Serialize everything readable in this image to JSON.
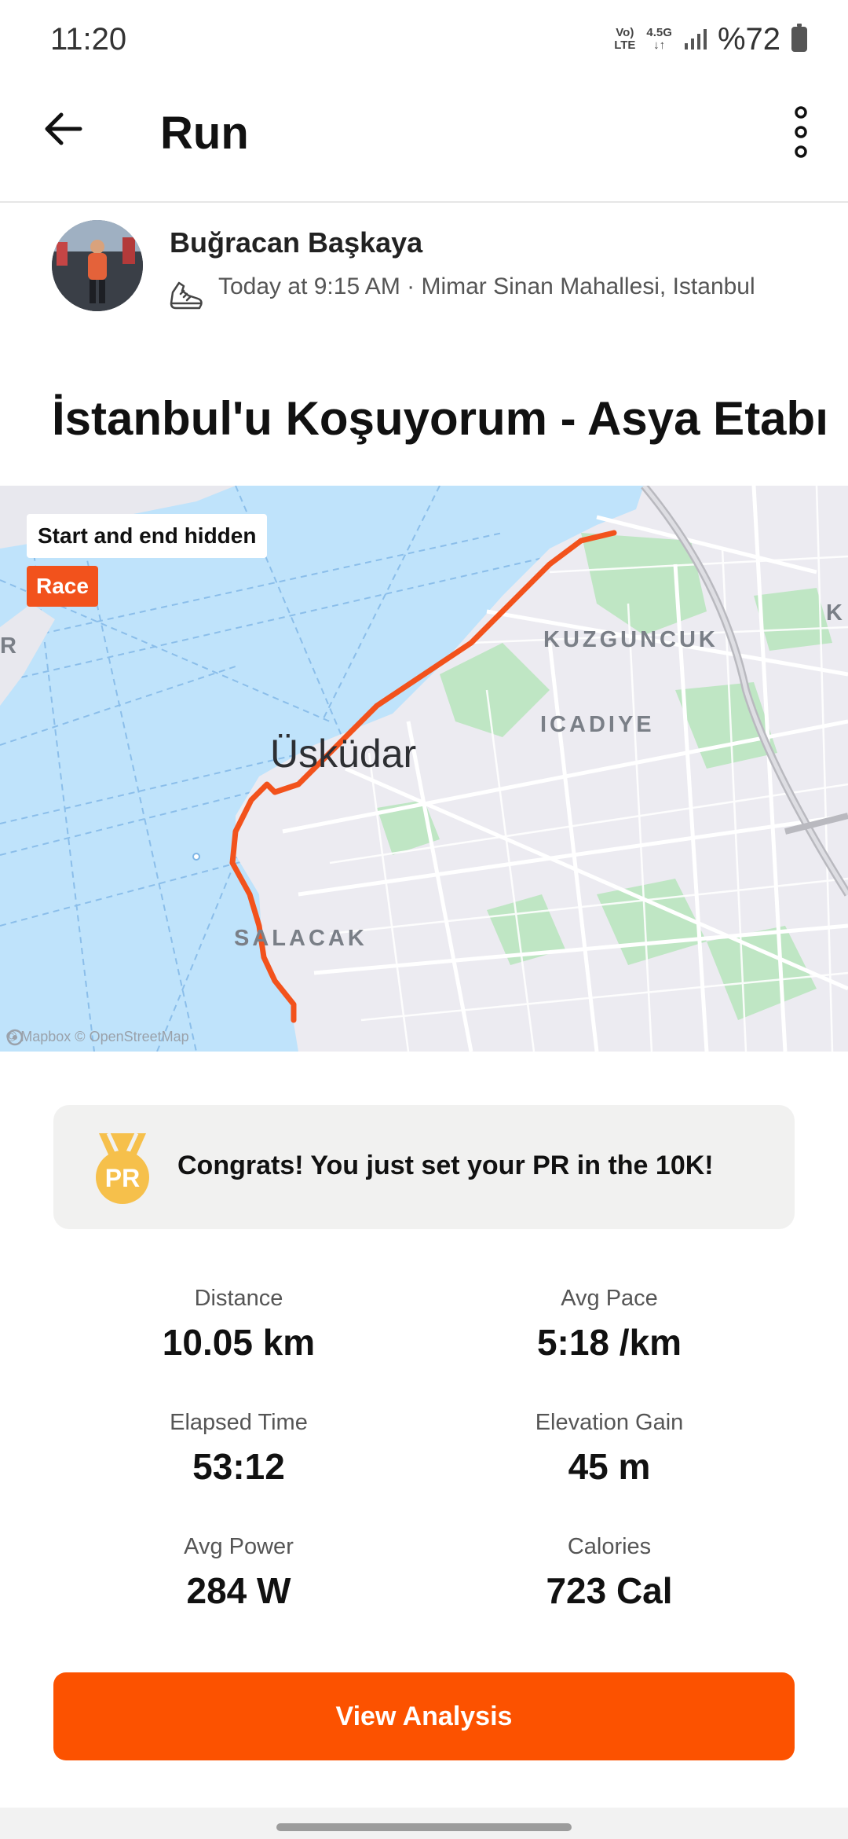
{
  "status_bar": {
    "time": "11:20",
    "network_top": "Vo)\nLTE",
    "network_mid": "4.5G",
    "battery": "%72"
  },
  "app_bar": {
    "title": "Run",
    "back_icon": "arrow-left-icon",
    "more_icon": "more-vertical-icon"
  },
  "athlete": {
    "name": "Buğracan Başkaya",
    "meta": "Today at 9:15 AM · Mimar Sinan Mahallesi, Istanbul",
    "activity_icon": "running-shoe-icon"
  },
  "activity": {
    "title": "İstanbul'u Koşuyorum - Asya Etabı"
  },
  "map": {
    "privacy_label": "Start and end hidden",
    "race_badge": "Race",
    "city": "Üsküdar",
    "places": [
      "KUZGUNCUK",
      "ICADIYE",
      "SALACAK"
    ],
    "edge_letters": [
      "R",
      "K"
    ],
    "attribution": "© Mapbox © OpenStreetMap",
    "route_color": "#f2521c",
    "water_color": "#bfe3fb"
  },
  "pr": {
    "icon": "pr-medal-icon",
    "badge_text": "PR",
    "text": "Congrats! You just set your PR in the 10K!"
  },
  "stats": [
    {
      "label": "Distance",
      "value": "10.05 km"
    },
    {
      "label": "Avg Pace",
      "value": "5:18 /km"
    },
    {
      "label": "Elapsed Time",
      "value": "53:12"
    },
    {
      "label": "Elevation Gain",
      "value": "45 m"
    },
    {
      "label": "Avg Power",
      "value": "284 W"
    },
    {
      "label": "Calories",
      "value": "723 Cal"
    }
  ],
  "actions": {
    "view_analysis": "View Analysis"
  },
  "colors": {
    "accent": "#fc5200",
    "medal": "#f6c04b"
  }
}
